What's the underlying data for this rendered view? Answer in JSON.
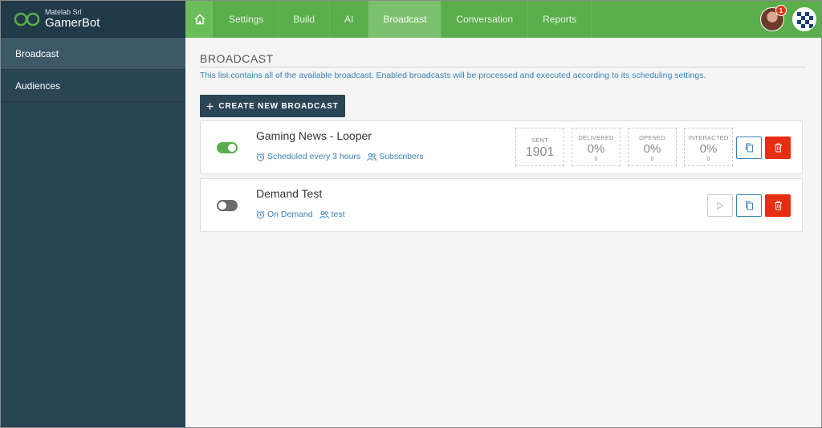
{
  "brand": {
    "org": "Matelab Srl",
    "name": "GamerBot"
  },
  "sidebar": {
    "items": [
      {
        "label": "Broadcast",
        "active": true
      },
      {
        "label": "Audiences",
        "active": false
      }
    ]
  },
  "nav": {
    "tabs": [
      {
        "label": "Settings"
      },
      {
        "label": "Build"
      },
      {
        "label": "AI"
      },
      {
        "label": "Broadcast",
        "active": true
      },
      {
        "label": "Conversation"
      },
      {
        "label": "Reports"
      }
    ],
    "notifications": "1"
  },
  "main": {
    "title": "BROADCAST",
    "description": "This list contains all of the available broadcast. Enabled broadcasts will be processed and executed according to its scheduling settings.",
    "create_label": "CREATE NEW BROADCAST"
  },
  "broadcasts": [
    {
      "title": "Gaming News - Looper",
      "enabled": true,
      "schedule": "Scheduled every 3 hours",
      "audience": "Subscribers",
      "stats": {
        "sent": {
          "label": "SENT",
          "value": "1901"
        },
        "delivered": {
          "label": "DELIVERED",
          "value": "0%",
          "count": "0"
        },
        "opened": {
          "label": "OPENED",
          "value": "0%",
          "count": "0"
        },
        "interacted": {
          "label": "INTERACTED",
          "value": "0%",
          "count": "0"
        }
      }
    },
    {
      "title": "Demand Test",
      "enabled": false,
      "schedule": "On Demand",
      "audience": "test"
    }
  ],
  "colors": {
    "nav_green": "#5aad4b",
    "sidebar": "#2a4556",
    "link_blue": "#3a83b8",
    "danger": "#e52e12"
  }
}
